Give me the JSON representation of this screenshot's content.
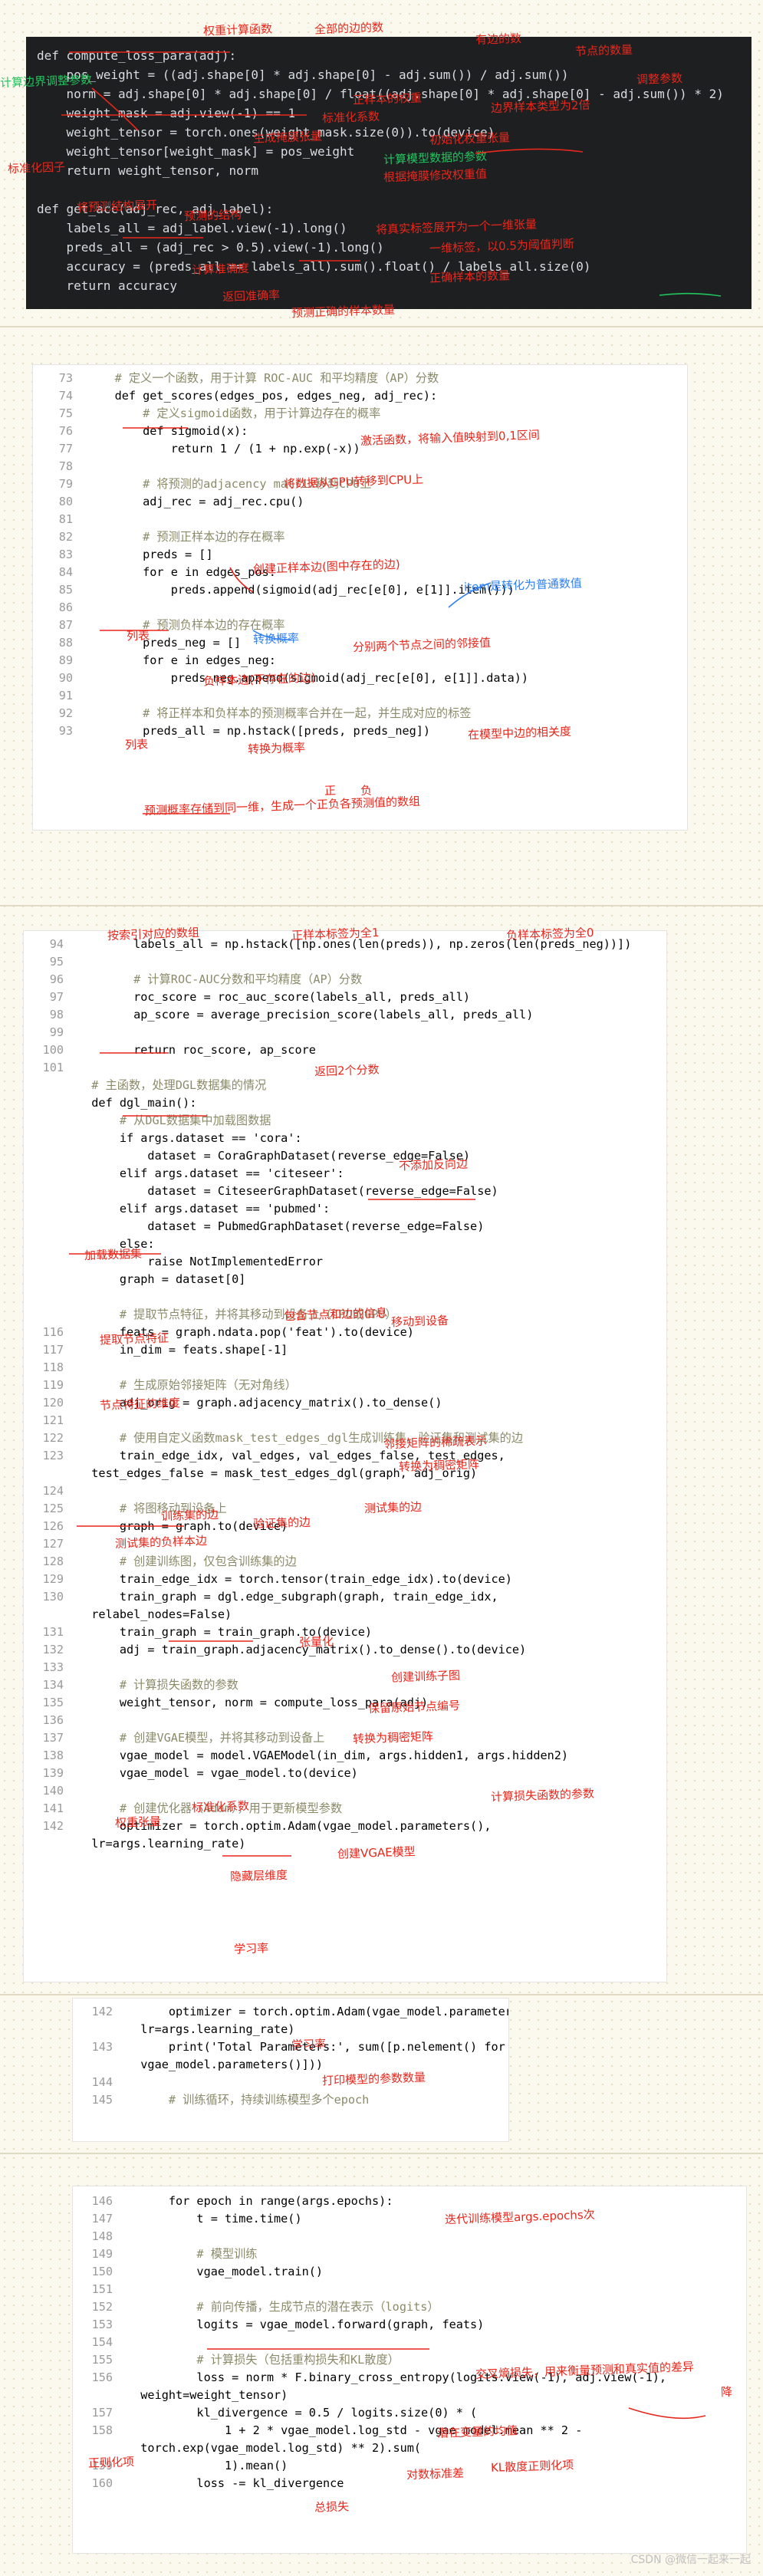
{
  "panel1": {
    "lines": [
      "def compute_loss_para(adj):",
      "    pos_weight = ((adj.shape[0] * adj.shape[0] - adj.sum()) / adj.sum())",
      "    norm = adj.shape[0] * adj.shape[0] / float((adj.shape[0] * adj.shape[0] - adj.sum()) * 2)",
      "    weight_mask = adj.view(-1) == 1",
      "    weight_tensor = torch.ones(weight_mask.size(0)).to(device)",
      "    weight_tensor[weight_mask] = pos_weight",
      "    return weight_tensor, norm",
      "",
      "def get_acc(adj_rec, adj_label):",
      "    labels_all = adj_label.view(-1).long()",
      "    preds_all = (adj_rec > 0.5).view(-1).long()",
      "    accuracy = (preds_all == labels_all).sum().float() / labels_all.size(0)",
      "    return accuracy"
    ],
    "notes": [
      "权重计算函数",
      "全部的边的数",
      "有边的数",
      "节点的数量",
      "计算边界调整参数",
      "调整参数",
      "正样本的权重",
      "标准化系数",
      "生成掩膜张量",
      "边界样本类型为2倍",
      "初始化权重张量",
      "根据掩膜修改权重值",
      "计算模型数据的参数",
      "将预测结构展开",
      "预测的结构",
      "将真实标签展开为一个一维张量",
      "一维标签，以0.5为阈值判断",
      "计算准确度",
      "正确样本的数量",
      "预测正确的样本数量",
      "返回准确率",
      "标准化因子"
    ]
  },
  "panel2": {
    "lines": [
      {
        "n": "73",
        "t": "    # 定义一个函数，用于计算 ROC-AUC 和平均精度（AP）分数"
      },
      {
        "n": "74",
        "t": "    def get_scores(edges_pos, edges_neg, adj_rec):"
      },
      {
        "n": "75",
        "t": "        # 定义sigmoid函数，用于计算边存在的概率"
      },
      {
        "n": "76",
        "t": "        def sigmoid(x):"
      },
      {
        "n": "77",
        "t": "            return 1 / (1 + np.exp(-x))"
      },
      {
        "n": "78",
        "t": ""
      },
      {
        "n": "79",
        "t": "        # 将预测的adjacency matrix移到CPU上"
      },
      {
        "n": "80",
        "t": "        adj_rec = adj_rec.cpu()"
      },
      {
        "n": "81",
        "t": ""
      },
      {
        "n": "82",
        "t": "        # 预测正样本边的存在概率"
      },
      {
        "n": "83",
        "t": "        preds = []"
      },
      {
        "n": "84",
        "t": "        for e in edges_pos:"
      },
      {
        "n": "85",
        "t": "            preds.append(sigmoid(adj_rec[e[0], e[1]].item()))"
      },
      {
        "n": "86",
        "t": ""
      },
      {
        "n": "87",
        "t": "        # 预测负样本边的存在概率"
      },
      {
        "n": "88",
        "t": "        preds_neg = []"
      },
      {
        "n": "89",
        "t": "        for e in edges_neg:"
      },
      {
        "n": "90",
        "t": "            preds_neg.append(sigmoid(adj_rec[e[0], e[1]].data))"
      },
      {
        "n": "91",
        "t": ""
      },
      {
        "n": "92",
        "t": "        # 将正样本和负样本的预测概率合并在一起，并生成对应的标签"
      },
      {
        "n": "93",
        "t": "        preds_all = np.hstack([preds, preds_neg])"
      }
    ],
    "notes": [
      "激活函数，将输入值映射到0,1区间",
      "将数据从GPU转移到CPU上",
      "创建正样本边(图中存在的边)",
      "item是转化为普通数值",
      "列表",
      "转换概率",
      "分别两个节点之间的邻接值",
      "负样本边(不存在的边)",
      "列表",
      "转换为概率",
      "在模型中边的相关度",
      "预测概率存储到同一维，生成一个正负各预测值的数组",
      "正",
      "负"
    ]
  },
  "panel3": {
    "lines": [
      {
        "n": "94",
        "t": "        labels_all = np.hstack([np.ones(len(preds)), np.zeros(len(preds_neg))])"
      },
      {
        "n": "95",
        "t": ""
      },
      {
        "n": "96",
        "t": "        # 计算ROC-AUC分数和平均精度（AP）分数"
      },
      {
        "n": "97",
        "t": "        roc_score = roc_auc_score(labels_all, preds_all)"
      },
      {
        "n": "98",
        "t": "        ap_score = average_precision_score(labels_all, preds_all)"
      },
      {
        "n": "99",
        "t": ""
      },
      {
        "n": "100",
        "t": "        return roc_score, ap_score"
      },
      {
        "n": "101",
        "t": ""
      },
      {
        "n": "",
        "t": "  # 主函数，处理DGL数据集的情况"
      },
      {
        "n": "",
        "t": "  def dgl_main():"
      },
      {
        "n": "",
        "t": "      # 从DGL数据集中加载图数据"
      },
      {
        "n": "",
        "t": "      if args.dataset == 'cora':"
      },
      {
        "n": "",
        "t": "          dataset = CoraGraphDataset(reverse_edge=False)"
      },
      {
        "n": "",
        "t": "      elif args.dataset == 'citeseer':"
      },
      {
        "n": "",
        "t": "          dataset = CiteseerGraphDataset(reverse_edge=False)"
      },
      {
        "n": "",
        "t": "      elif args.dataset == 'pubmed':"
      },
      {
        "n": "",
        "t": "          dataset = PubmedGraphDataset(reverse_edge=False)"
      },
      {
        "n": "",
        "t": "      else:"
      },
      {
        "n": "",
        "t": "          raise NotImplementedError"
      },
      {
        "n": "",
        "t": "      graph = dataset[0]"
      },
      {
        "n": "",
        "t": ""
      },
      {
        "n": "",
        "t": "      # 提取节点特征，并将其移动到设备上（CPU或GPU）"
      },
      {
        "n": "116",
        "t": "      feats = graph.ndata.pop('feat').to(device)"
      },
      {
        "n": "117",
        "t": "      in_dim = feats.shape[-1]"
      },
      {
        "n": "118",
        "t": ""
      },
      {
        "n": "119",
        "t": "      # 生成原始邻接矩阵（无对角线）"
      },
      {
        "n": "120",
        "t": "      adj_orig = graph.adjacency_matrix().to_dense()"
      },
      {
        "n": "121",
        "t": ""
      },
      {
        "n": "122",
        "t": "      # 使用自定义函数mask_test_edges_dgl生成训练集、验证集和测试集的边"
      },
      {
        "n": "123",
        "t": "      train_edge_idx, val_edges, val_edges_false, test_edges,"
      },
      {
        "n": "",
        "t": "  test_edges_false = mask_test_edges_dgl(graph, adj_orig)"
      },
      {
        "n": "124",
        "t": ""
      },
      {
        "n": "125",
        "t": "      # 将图移动到设备上"
      },
      {
        "n": "126",
        "t": "      graph = graph.to(device)"
      },
      {
        "n": "127",
        "t": ""
      },
      {
        "n": "128",
        "t": "      # 创建训练图，仅包含训练集的边"
      },
      {
        "n": "129",
        "t": "      train_edge_idx = torch.tensor(train_edge_idx).to(device)"
      },
      {
        "n": "130",
        "t": "      train_graph = dgl.edge_subgraph(graph, train_edge_idx,"
      },
      {
        "n": "",
        "t": "  relabel_nodes=False)"
      },
      {
        "n": "131",
        "t": "      train_graph = train_graph.to(device)"
      },
      {
        "n": "132",
        "t": "      adj = train_graph.adjacency_matrix().to_dense().to(device)"
      },
      {
        "n": "133",
        "t": ""
      },
      {
        "n": "134",
        "t": "      # 计算损失函数的参数"
      },
      {
        "n": "135",
        "t": "      weight_tensor, norm = compute_loss_para(adj)"
      },
      {
        "n": "136",
        "t": ""
      },
      {
        "n": "137",
        "t": "      # 创建VGAE模型，并将其移动到设备上"
      },
      {
        "n": "138",
        "t": "      vgae_model = model.VGAEModel(in_dim, args.hidden1, args.hidden2)"
      },
      {
        "n": "139",
        "t": "      vgae_model = vgae_model.to(device)"
      },
      {
        "n": "140",
        "t": ""
      },
      {
        "n": "141",
        "t": "      # 创建优化器（Adam），用于更新模型参数"
      },
      {
        "n": "142",
        "t": "      optimizer = torch.optim.Adam(vgae_model.parameters(),"
      },
      {
        "n": "",
        "t": "  lr=args.learning_rate)"
      }
    ],
    "notes": [
      "按索引对应的数组",
      "正样本标签为全1",
      "负样本标签为全0",
      "返回2个分数",
      "不添加反向边",
      "加载数据集",
      "包含节点和边的信息",
      "提取节点特征",
      "移动到设备",
      "节点特征的维度",
      "转换为稠密矩阵",
      "邻接矩阵的稀疏表示",
      "训练集的边",
      "验证集的边",
      "测试集的边",
      "测试集的负样本边",
      "张量化",
      "创建训练子图",
      "保留原始节点编号",
      "转换为稠密矩阵",
      "权重张量",
      "标准化系数",
      "计算损失函数的参数",
      "创建VGAE模型",
      "隐藏层维度",
      "学习率"
    ]
  },
  "panel4": {
    "lines": [
      {
        "n": "142",
        "t": "      optimizer = torch.optim.Adam(vgae_model.parameters(),"
      },
      {
        "n": "",
        "t": "  lr=args.learning_rate)"
      },
      {
        "n": "143",
        "t": "      print('Total Parameters:', sum([p.nelement() for p in"
      },
      {
        "n": "",
        "t": "  vgae_model.parameters()]))"
      },
      {
        "n": "144",
        "t": ""
      },
      {
        "n": "145",
        "t": "      # 训练循环，持续训练模型多个epoch"
      }
    ],
    "notes": [
      "学习率",
      "打印模型的参数数量"
    ]
  },
  "panel5": {
    "lines": [
      {
        "n": "146",
        "t": "      for epoch in range(args.epochs):"
      },
      {
        "n": "147",
        "t": "          t = time.time()"
      },
      {
        "n": "148",
        "t": ""
      },
      {
        "n": "149",
        "t": "          # 模型训练"
      },
      {
        "n": "150",
        "t": "          vgae_model.train()"
      },
      {
        "n": "151",
        "t": ""
      },
      {
        "n": "152",
        "t": "          # 前向传播，生成节点的潜在表示（logits）"
      },
      {
        "n": "153",
        "t": "          logits = vgae_model.forward(graph, feats)"
      },
      {
        "n": "154",
        "t": ""
      },
      {
        "n": "155",
        "t": "          # 计算损失（包括重构损失和KL散度）"
      },
      {
        "n": "156",
        "t": "          loss = norm * F.binary_cross_entropy(logits.view(-1), adj.view(-1),"
      },
      {
        "n": "",
        "t": "  weight=weight_tensor)"
      },
      {
        "n": "157",
        "t": "          kl_divergence = 0.5 / logits.size(0) * ("
      },
      {
        "n": "158",
        "t": "              1 + 2 * vgae_model.log_std - vgae_model.mean ** 2 -"
      },
      {
        "n": "",
        "t": "  torch.exp(vgae_model.log_std) ** 2).sum("
      },
      {
        "n": "159",
        "t": "              1).mean()"
      },
      {
        "n": "160",
        "t": "          loss -= kl_divergence"
      }
    ],
    "notes": [
      "迭代训练模型args.epochs次",
      "交叉熵损失，用来衡量预测和真实值的差异",
      "降",
      "潜在变量的均值",
      "对数标准差",
      "正则化项",
      "KL散度正则化项",
      "总损失"
    ]
  },
  "watermark": "CSDN @微信一起来一起"
}
